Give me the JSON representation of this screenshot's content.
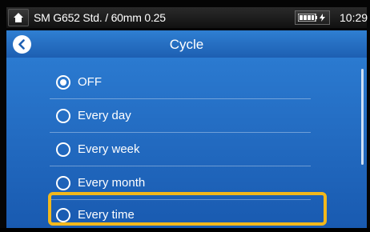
{
  "status": {
    "recipe": "SM G652 Std. / 60mm 0.25",
    "time": "10:29"
  },
  "header": {
    "title": "Cycle"
  },
  "options": [
    {
      "label": "OFF",
      "selected": true
    },
    {
      "label": "Every day",
      "selected": false
    },
    {
      "label": "Every week",
      "selected": false
    },
    {
      "label": "Every month",
      "selected": false
    },
    {
      "label": "Every time",
      "selected": false
    }
  ],
  "highlighted_option": "Every time",
  "colors": {
    "accent": "#2b7ad0",
    "highlight": "#f2b81c"
  }
}
